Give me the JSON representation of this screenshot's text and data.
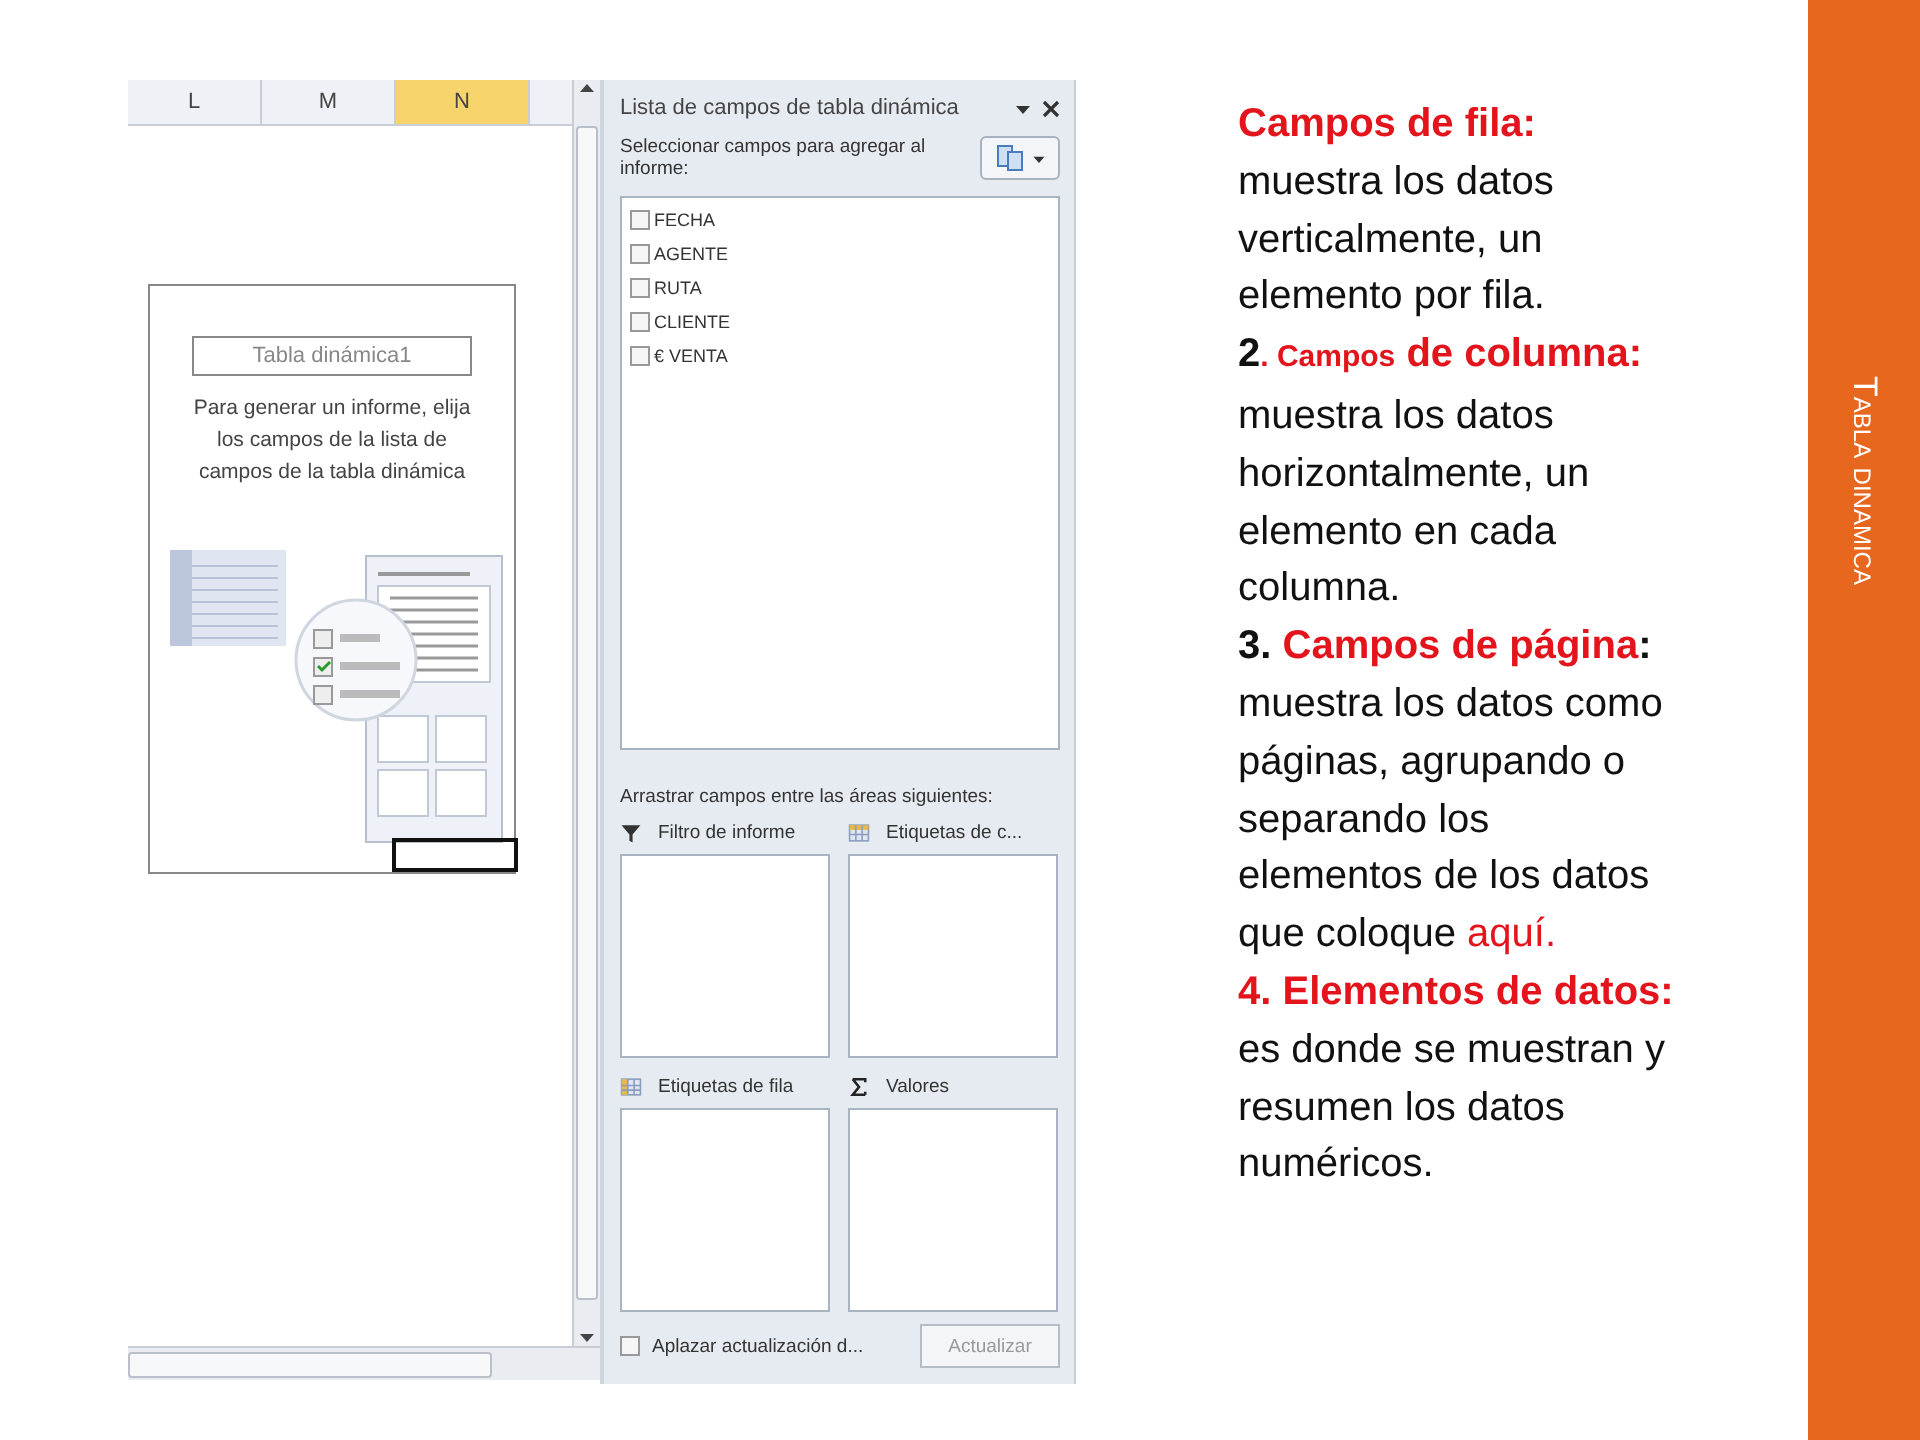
{
  "sheet": {
    "columns": [
      {
        "label": "L",
        "selected": false
      },
      {
        "label": "M",
        "selected": false
      },
      {
        "label": "N",
        "selected": true
      }
    ],
    "placeholder": {
      "title": "Tabla dinámica1",
      "message": "Para generar un informe, elija los campos de la lista de campos de la tabla dinámica"
    }
  },
  "field_list": {
    "title": "Lista de campos de tabla dinámica",
    "instruction": "Seleccionar campos para agregar al informe:",
    "fields": [
      {
        "label": "FECHA",
        "checked": false
      },
      {
        "label": "AGENTE",
        "checked": false
      },
      {
        "label": "RUTA",
        "checked": false
      },
      {
        "label": "CLIENTE",
        "checked": false
      },
      {
        "label": "€ VENTA",
        "checked": false
      }
    ],
    "drag_instruction": "Arrastrar campos entre las áreas siguientes:",
    "areas": [
      {
        "label": "Filtro de informe",
        "kind": "filter"
      },
      {
        "label": "Etiquetas de c...",
        "kind": "columns"
      },
      {
        "label": "Etiquetas de fila",
        "kind": "rows"
      },
      {
        "label": "Valores",
        "kind": "values"
      }
    ],
    "defer": {
      "label": "Aplazar actualización d...",
      "checked": false
    },
    "update_button": "Actualizar"
  },
  "paragraphs": [
    [
      {
        "kind": "heading",
        "text": "Campos de fila:"
      },
      {
        "kind": "body",
        "text": " muestra los datos verticalmente, un elemento por fila."
      }
    ],
    [
      {
        "kind": "number",
        "text": "2"
      },
      {
        "kind": "small-heading",
        "text": ". Campos"
      },
      {
        "kind": "heading",
        "text": " de columna:"
      },
      {
        "kind": "body",
        "text": " muestra los datos horizontalmente, un elemento en cada columna."
      }
    ],
    [
      {
        "kind": "number",
        "text": "3. "
      },
      {
        "kind": "heading",
        "text": "Campos de página"
      },
      {
        "kind": "number",
        "text": ":"
      },
      {
        "kind": "body",
        "text": " muestra los datos como páginas, agrupando o separando los elementos de los datos que coloque "
      },
      {
        "kind": "highlight",
        "text": "aquí."
      }
    ],
    [
      {
        "kind": "heading",
        "text": "4. Elementos de datos:"
      },
      {
        "kind": "body",
        "text": " es donde se muestran y resumen los datos numéricos."
      }
    ]
  ],
  "slide_title": "Tabla dinamica"
}
